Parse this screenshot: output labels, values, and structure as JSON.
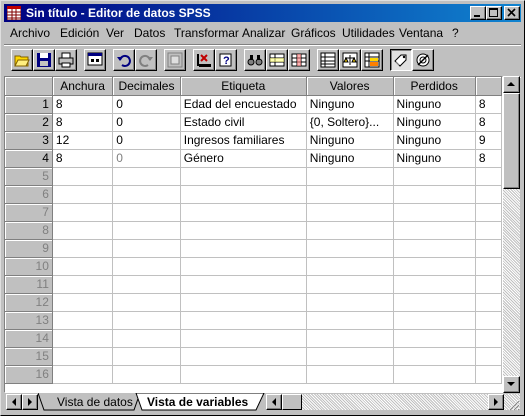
{
  "window": {
    "title": "Sin título - Editor de datos SPSS"
  },
  "menu": [
    {
      "label": "Archivo"
    },
    {
      "label": "Edición"
    },
    {
      "label": "Ver"
    },
    {
      "label": "Datos"
    },
    {
      "label": "Transformar"
    },
    {
      "label": "Analizar"
    },
    {
      "label": "Gráficos"
    },
    {
      "label": "Utilidades"
    },
    {
      "label": "Ventana"
    },
    {
      "label": "?"
    }
  ],
  "toolbar": {
    "buttons": [
      "open-icon",
      "save-icon",
      "print-icon",
      "dialog-recall-icon",
      "undo-icon",
      "redo-icon",
      "goto-chart-icon",
      "goto-case-icon",
      "variables-icon",
      "find-icon",
      "insert-case-icon",
      "insert-variable-icon",
      "split-file-icon",
      "weight-cases-icon",
      "select-cases-icon",
      "value-labels-icon",
      "use-sets-icon"
    ]
  },
  "grid": {
    "columns": [
      "Anchura",
      "Decimales",
      "Etiqueta",
      "Valores",
      "Perdidos"
    ],
    "rows": [
      {
        "n": "1",
        "anchura": "8",
        "decimales": "0",
        "etiqueta": "Edad del encuestado",
        "valores": "Ninguno",
        "perdidos": "Ninguno",
        "extra": "8"
      },
      {
        "n": "2",
        "anchura": "8",
        "decimales": "0",
        "etiqueta": "Estado civil",
        "valores": "{0, Soltero}...",
        "perdidos": "Ninguno",
        "extra": "8"
      },
      {
        "n": "3",
        "anchura": "12",
        "decimales": "0",
        "etiqueta": "Ingresos familiares",
        "valores": "Ninguno",
        "perdidos": "Ninguno",
        "extra": "9"
      },
      {
        "n": "4",
        "anchura": "8",
        "decimales": "0",
        "etiqueta": "Género",
        "valores": "Ninguno",
        "perdidos": "Ninguno",
        "extra": "8"
      }
    ],
    "empty_rows": [
      "5",
      "6",
      "7",
      "8",
      "9",
      "10",
      "11",
      "12",
      "13",
      "14",
      "15",
      "16"
    ]
  },
  "tabs": {
    "data_view": "Vista de datos",
    "variable_view": "Vista de variables"
  }
}
